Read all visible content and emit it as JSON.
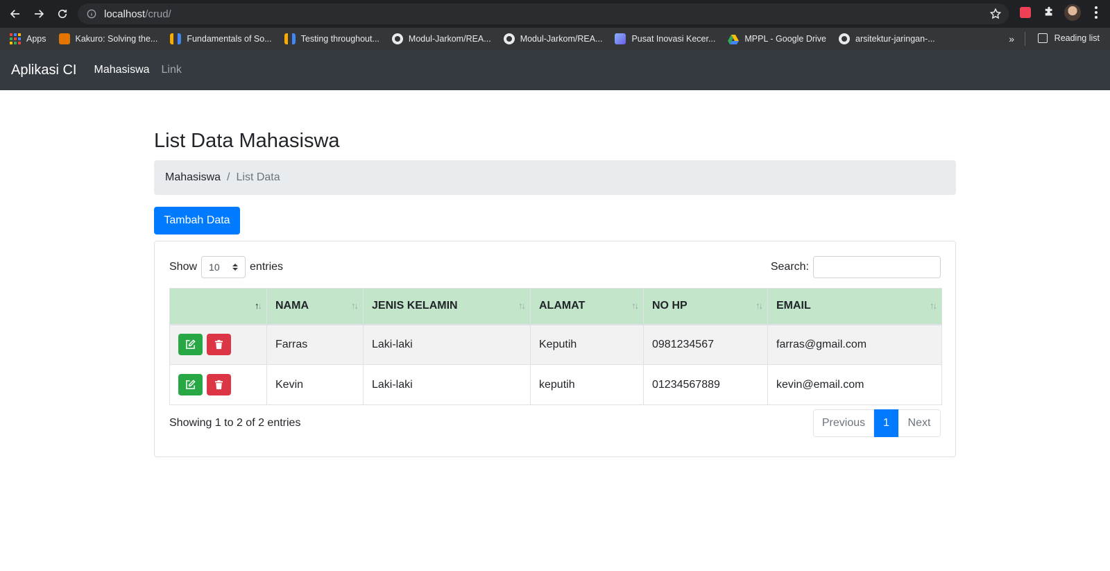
{
  "browser": {
    "url_host": "localhost",
    "url_path": "/crud/",
    "bookmarks": [
      "Apps",
      "Kakuro: Solving the...",
      "Fundamentals of So...",
      "Testing throughout...",
      "Modul-Jarkom/REA...",
      "Modul-Jarkom/REA...",
      "Pusat Inovasi Kecer...",
      "MPPL - Google Drive",
      "arsitektur-jaringan-..."
    ],
    "more": "»",
    "reading_list": "Reading list"
  },
  "navbar": {
    "brand": "Aplikasi CI",
    "links": [
      "Mahasiswa",
      "Link"
    ]
  },
  "page": {
    "title": "List Data Mahasiswa",
    "breadcrumb": [
      "Mahasiswa",
      "List Data"
    ],
    "breadcrumb_sep": "/",
    "add_button": "Tambah Data"
  },
  "datatable": {
    "show_label": "Show",
    "entries_value": "10",
    "entries_label": "entries",
    "search_label": "Search:",
    "columns": [
      "",
      "NAMA",
      "JENIS KELAMIN",
      "ALAMAT",
      "NO HP",
      "EMAIL"
    ],
    "rows": [
      [
        "Farras",
        "Laki-laki",
        "Keputih",
        "0981234567",
        "farras@gmail.com"
      ],
      [
        "Kevin",
        "Laki-laki",
        "keputih",
        "01234567889",
        "kevin@email.com"
      ]
    ],
    "info": "Showing 1 to 2 of 2 entries",
    "pagination": {
      "previous": "Previous",
      "current": "1",
      "next": "Next"
    }
  },
  "colors": {
    "navbar_bg": "#343a40",
    "primary": "#007bff",
    "success": "#28a745",
    "danger": "#dc3545",
    "table_header": "#c3e6cb"
  }
}
